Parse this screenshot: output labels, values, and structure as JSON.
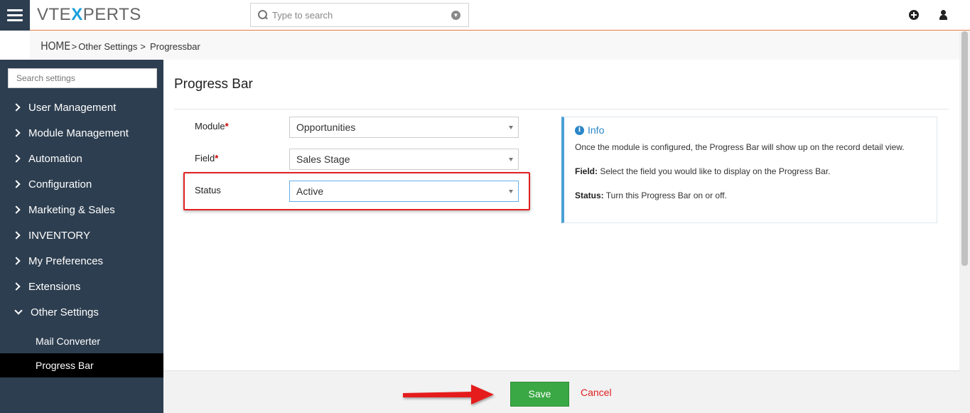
{
  "header": {
    "logo": {
      "vt": "VTE",
      "x": "X",
      "perts": "PERTS"
    },
    "search_placeholder": "Type to search",
    "icons": [
      "menu-icon",
      "search-icon",
      "chevron-down-icon",
      "plus-icon",
      "user-icon"
    ]
  },
  "breadcrumb": {
    "home": "HOME",
    "sep": ">",
    "items": [
      "Other Settings",
      "Progressbar"
    ]
  },
  "sidebar": {
    "search_placeholder": "Search settings",
    "items": [
      {
        "label": "User Management"
      },
      {
        "label": "Module Management"
      },
      {
        "label": "Automation"
      },
      {
        "label": "Configuration"
      },
      {
        "label": "Marketing & Sales"
      },
      {
        "label": "INVENTORY"
      },
      {
        "label": "My Preferences"
      },
      {
        "label": "Extensions"
      },
      {
        "label": "Other Settings",
        "expanded": true
      }
    ],
    "sub_items": [
      {
        "label": "Mail Converter",
        "active": false
      },
      {
        "label": "Progress Bar",
        "active": true
      }
    ]
  },
  "main": {
    "title": "Progress Bar",
    "form": {
      "module": {
        "label": "Module",
        "required": "*",
        "value": "Opportunities"
      },
      "field": {
        "label": "Field",
        "required": "*",
        "value": "Sales Stage"
      },
      "status": {
        "label": "Status",
        "value": "Active"
      }
    },
    "info": {
      "title": "Info",
      "intro": "Once the module is configured, the Progress Bar will show up on the record detail view.",
      "field_label": "Field:",
      "field_text": " Select the field you would like to display on the Progress Bar.",
      "status_label": "Status:",
      "status_text": " Turn this Progress Bar on or off."
    }
  },
  "footer": {
    "save_label": "Save",
    "cancel_label": "Cancel"
  },
  "colors": {
    "sidebar_bg": "#2d3e50",
    "accent_orange": "#e8763b",
    "save_green": "#3aa844",
    "cancel_red": "#e02020",
    "info_blue": "#2a86c8",
    "highlight_red": "#e02020"
  }
}
